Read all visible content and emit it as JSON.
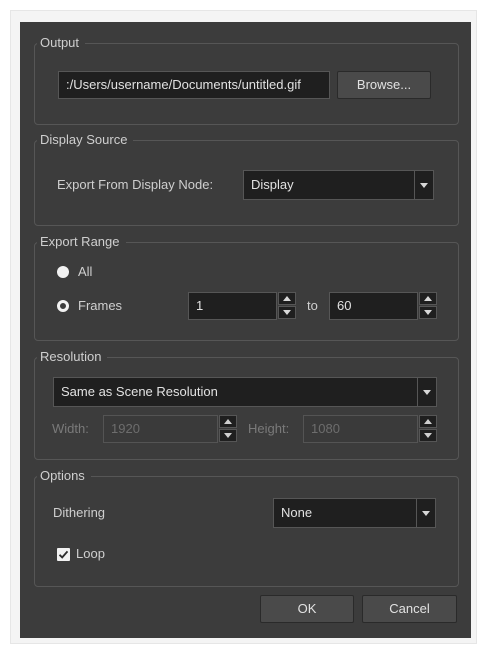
{
  "output": {
    "title": "Output",
    "path": ":/Users/username/Documents/untitled.gif",
    "browse_label": "Browse..."
  },
  "display_source": {
    "title": "Display Source",
    "label": "Export From Display Node:",
    "selected": "Display"
  },
  "export_range": {
    "title": "Export Range",
    "all_label": "All",
    "frames_label": "Frames",
    "selected": "Frames",
    "from": "1",
    "to_label": "to",
    "to": "60"
  },
  "resolution": {
    "title": "Resolution",
    "preset": "Same as Scene Resolution",
    "width_label": "Width:",
    "width": "1920",
    "height_label": "Height:",
    "height": "1080"
  },
  "options": {
    "title": "Options",
    "dithering_label": "Dithering",
    "dithering": "None",
    "loop_label": "Loop",
    "loop_checked": true
  },
  "footer": {
    "ok_label": "OK",
    "cancel_label": "Cancel"
  },
  "colors": {
    "dialog_bg": "#3c3c3c",
    "field_bg": "#1f1f1f",
    "border": "#565656",
    "text": "#d4d4d4"
  }
}
